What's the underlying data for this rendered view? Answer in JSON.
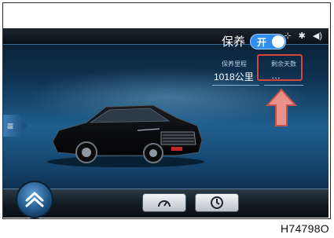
{
  "status_bar": {
    "icons": [
      "antenna-icon",
      "bluetooth-icon",
      "volume-icon"
    ],
    "glyphs": [
      "⊹",
      "✱",
      "◀)"
    ]
  },
  "maintenance": {
    "label": "保养",
    "toggle_text": "开",
    "toggle_on": true,
    "interval_label": "保养里程",
    "remaining_label": "剩余天数",
    "distance_value": "1018公里",
    "second_value": "…"
  },
  "side_tab": {
    "glyph": "≡"
  },
  "dock": {
    "home_glyph": "⌂",
    "buttons": [
      "gauge-icon",
      "clock-icon"
    ]
  },
  "figure_code": "H74798O",
  "colors": {
    "toggle": "#2f8ff0",
    "highlight": "#d9443b",
    "arrow": "#e8908a"
  }
}
